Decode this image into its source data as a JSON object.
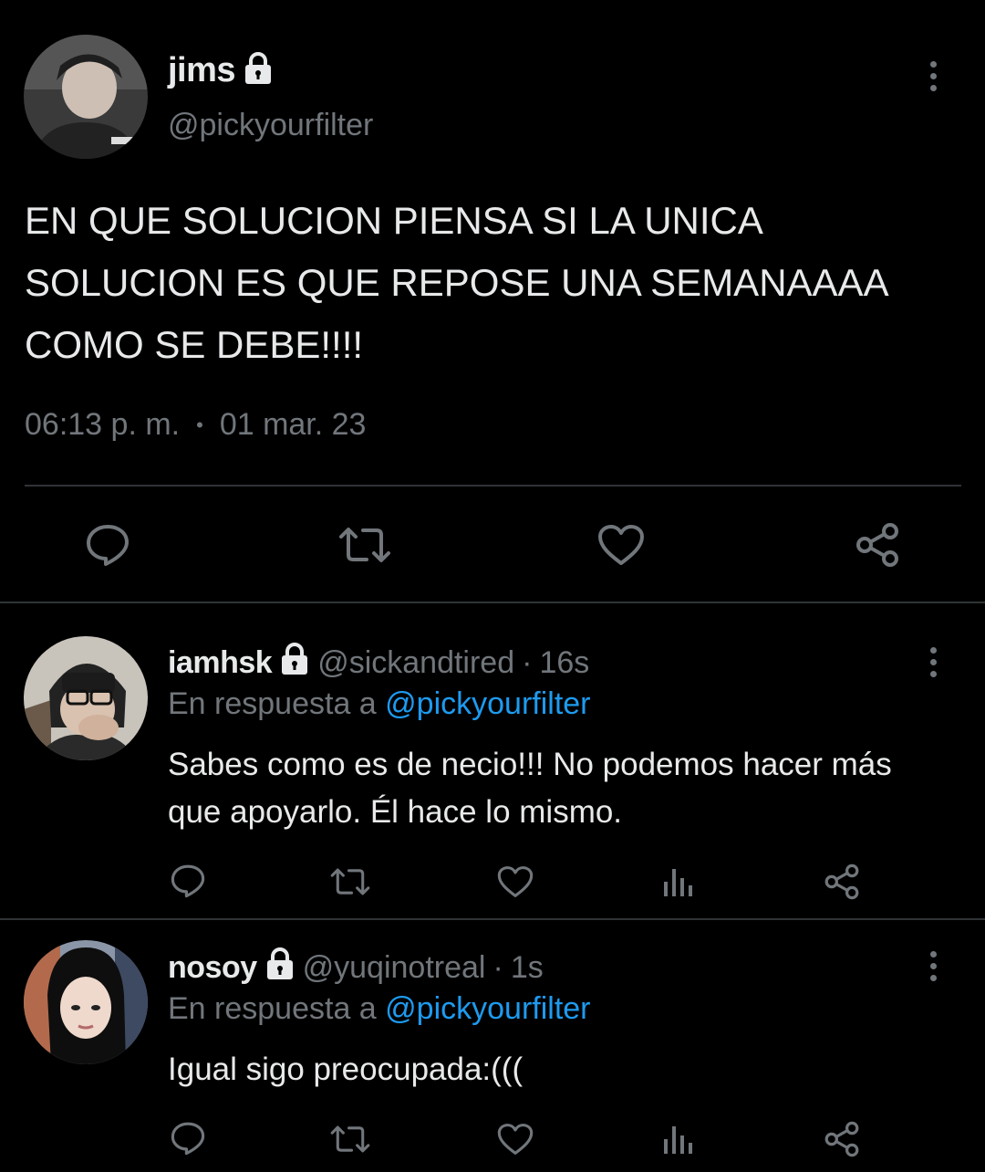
{
  "main_tweet": {
    "display_name": "jims",
    "handle": "@pickyourfilter",
    "text_lines": [
      "EN QUE SOLUCION PIENSA SI LA UNICA",
      "SOLUCION ES QUE REPOSE UNA SEMANAAAA",
      "COMO SE DEBE!!!!"
    ],
    "time": "06:13 p. m.",
    "separator": "•",
    "date": "01 mar. 23",
    "actions": [
      "reply-icon",
      "retweet-icon",
      "like-icon",
      "share-icon"
    ]
  },
  "replies": [
    {
      "display_name": "iamhsk",
      "handle": "@sickandtired",
      "time_sep": "·",
      "age": "16s",
      "reply_prefix": "En respuesta a",
      "reply_to": "@pickyourfilter",
      "text_lines": [
        "Sabes como es de necio!!! No podemos hacer más",
        "que apoyarlo. Él hace lo mismo."
      ],
      "actions": [
        "reply-icon",
        "retweet-icon",
        "like-icon",
        "views-icon",
        "share-icon"
      ]
    },
    {
      "display_name": "nosoy",
      "handle": "@yuqinotreal",
      "time_sep": "·",
      "age": "1s",
      "reply_prefix": "En respuesta a",
      "reply_to": "@pickyourfilter",
      "text_lines": [
        "Igual sigo preocupada:((("
      ],
      "actions": [
        "reply-icon",
        "retweet-icon",
        "like-icon",
        "views-icon",
        "share-icon"
      ]
    }
  ],
  "colors": {
    "background": "#000000",
    "text": "#e7e9ea",
    "muted": "#71767b",
    "link": "#1d9bf0",
    "divider": "#2f3336"
  }
}
